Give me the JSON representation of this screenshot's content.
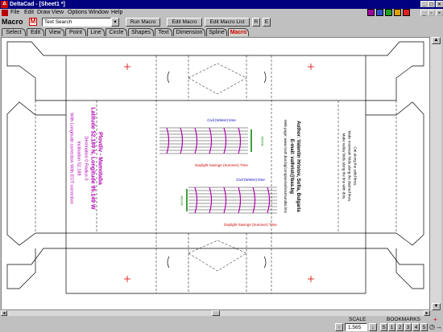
{
  "window": {
    "title": "DeltaCad - [Sheet1 *]",
    "app_icon": "deltacad-icon"
  },
  "menu": {
    "items": [
      "File",
      "Edit",
      "Draw",
      "View",
      "Options",
      "Window",
      "Help"
    ]
  },
  "colors": {
    "titlebar": "#000080",
    "accent": "#cc0000",
    "magenta": "#b000b0",
    "green": "#008000",
    "blue": "#0000c0"
  },
  "macro_toolbar": {
    "label": "Macro",
    "search_value": "Text Search",
    "run_label": "Run Macro",
    "edit_label": "Edit Macro",
    "edit_list_label": "Edit Macro List",
    "r_label": "R",
    "e_label": "E"
  },
  "tabs": [
    {
      "label": "Select",
      "active": false
    },
    {
      "label": "Edit",
      "active": false
    },
    {
      "label": "View",
      "active": false
    },
    {
      "label": "Point",
      "active": false
    },
    {
      "label": "Line",
      "active": false
    },
    {
      "label": "Circle",
      "active": false
    },
    {
      "label": "Shapes",
      "active": false
    },
    {
      "label": "Text",
      "active": false
    },
    {
      "label": "Dimension",
      "active": false
    },
    {
      "label": "Spline",
      "active": false
    },
    {
      "label": "Macro",
      "active": true
    }
  ],
  "drawing": {
    "lines_left": [
      "Plovdiv - Mamotaba",
      "Latitude 52.189 N, Longitude 95.149 W",
      "Declination 0    Radius 0",
      "Inclination 52.188",
      "With Longitude correction    With EOT correction"
    ],
    "civil_time": "Civil (Winter) time",
    "daylight_time": "Daylight Savings (Summer) Time",
    "author": [
      "Author: Valentin Hristov, Sofia, Bulgaria",
      "E-mail: valhrist@bas.bg"
    ],
    "webpage": "Web page: www.math.bas.bg/complan/valhrist/sundial.htm",
    "notes": [
      "Cut along the solid lines.",
      "Make mountain folds along the dashed lines.",
      "Make valley folds along the line with dots."
    ],
    "noon_label": "NOON"
  },
  "status": {
    "scale_label": "SCALE",
    "scale_value": "1.565",
    "bookmarks_label": "BOOKMARKS",
    "bookmarks": [
      "S",
      "1",
      "2",
      "3",
      "4",
      "5"
    ]
  }
}
